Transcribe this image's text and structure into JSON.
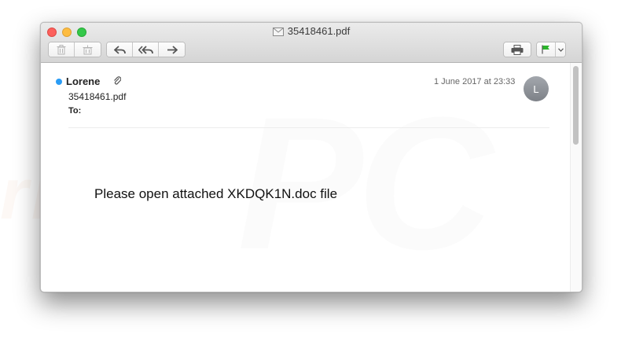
{
  "window": {
    "title": "35418461.pdf"
  },
  "toolbar": {
    "buttons": [
      {
        "name": "trash",
        "icon": "trash-icon"
      },
      {
        "name": "junk",
        "icon": "junk-icon"
      },
      {
        "name": "reply",
        "icon": "reply-arrow-icon"
      },
      {
        "name": "reply_all",
        "icon": "reply-all-arrow-icon"
      },
      {
        "name": "forward",
        "icon": "forward-arrow-icon"
      },
      {
        "name": "print",
        "icon": "printer-icon"
      },
      {
        "name": "flag",
        "icon": "flag-icon",
        "color": "#2bb52b"
      },
      {
        "name": "flag_menu",
        "icon": "chevron-down-icon"
      }
    ]
  },
  "message": {
    "sender": "Lorene",
    "unread_dot_color": "#2a9cf5",
    "has_attachment_icon": "paperclip-icon",
    "subject": "35418461.pdf",
    "to_label": "To:",
    "date": "1 June 2017 at 23:33",
    "avatar_initial": "L",
    "body": "Please open attached XKDQK1N.doc file"
  },
  "watermark": {
    "line1": "PC",
    "line2": "risk.com"
  }
}
